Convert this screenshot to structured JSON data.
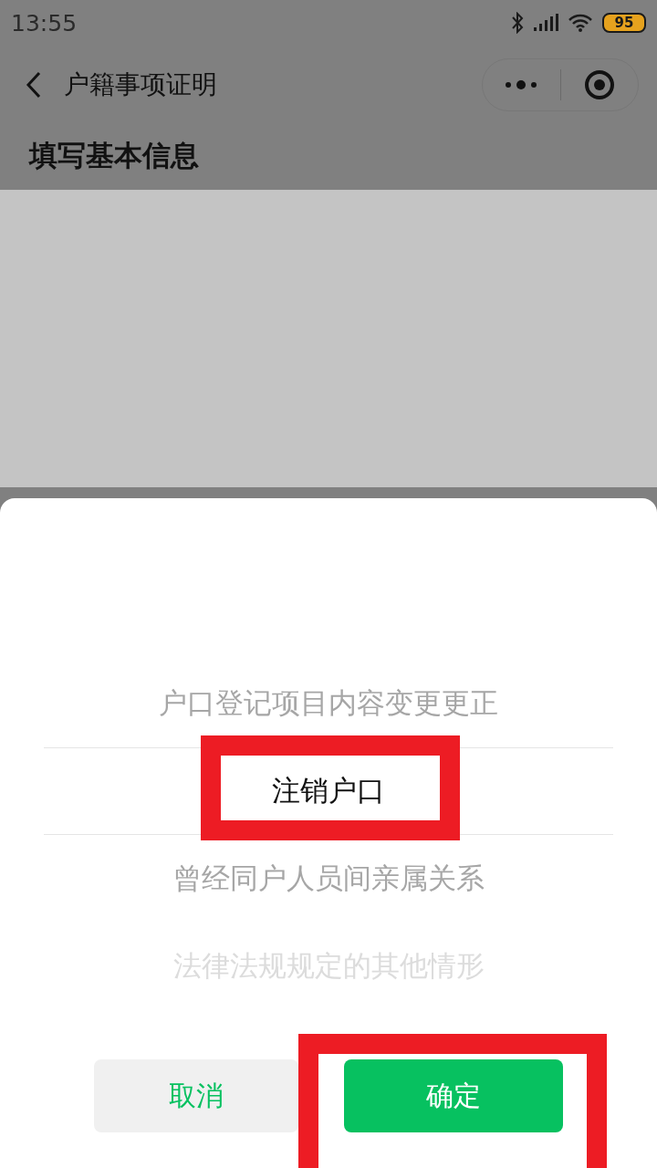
{
  "status_bar": {
    "time": "13:55",
    "battery": "95"
  },
  "nav": {
    "title": "户籍事项证明"
  },
  "section_title": "填写基本信息",
  "picker": {
    "options": [
      {
        "label": "户口登记项目内容变更更正",
        "selected": false
      },
      {
        "label": "注销户口",
        "selected": true
      },
      {
        "label": "曾经同户人员间亲属关系",
        "selected": false
      },
      {
        "label": "法律法规规定的其他情形",
        "selected": false
      }
    ]
  },
  "buttons": {
    "cancel": "取消",
    "confirm": "确定"
  }
}
